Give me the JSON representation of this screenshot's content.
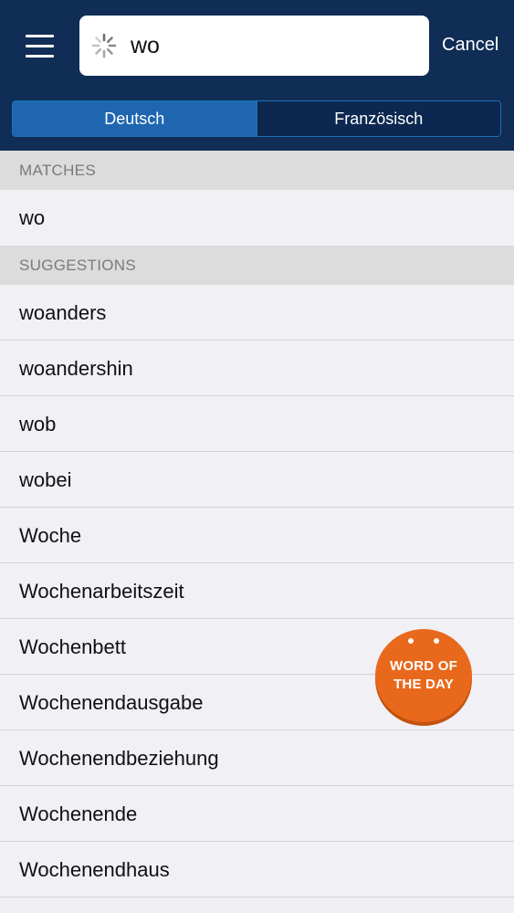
{
  "header": {
    "search": {
      "value": "wo",
      "placeholder": ""
    },
    "cancel_label": "Cancel",
    "tabs": [
      {
        "label": "Deutsch",
        "active": true
      },
      {
        "label": "Französisch",
        "active": false
      }
    ]
  },
  "matches": {
    "title": "MATCHES",
    "items": [
      "wo"
    ]
  },
  "suggestions": {
    "title": "SUGGESTIONS",
    "items": [
      "woanders",
      "woandershin",
      "wob",
      "wobei",
      "Woche",
      "Wochenarbeitszeit",
      "Wochenbett",
      "Wochenendausgabe",
      "Wochenendbeziehung",
      "Wochenende",
      "Wochenendhaus"
    ]
  },
  "word_of_the_day": {
    "line1": "WORD OF",
    "line2": "THE DAY"
  },
  "colors": {
    "header_bg": "#0f2d55",
    "active_tab": "#1e67b0",
    "badge": "#e8691c"
  },
  "icons": [
    "hamburger-menu-icon",
    "loading-spinner-icon"
  ]
}
